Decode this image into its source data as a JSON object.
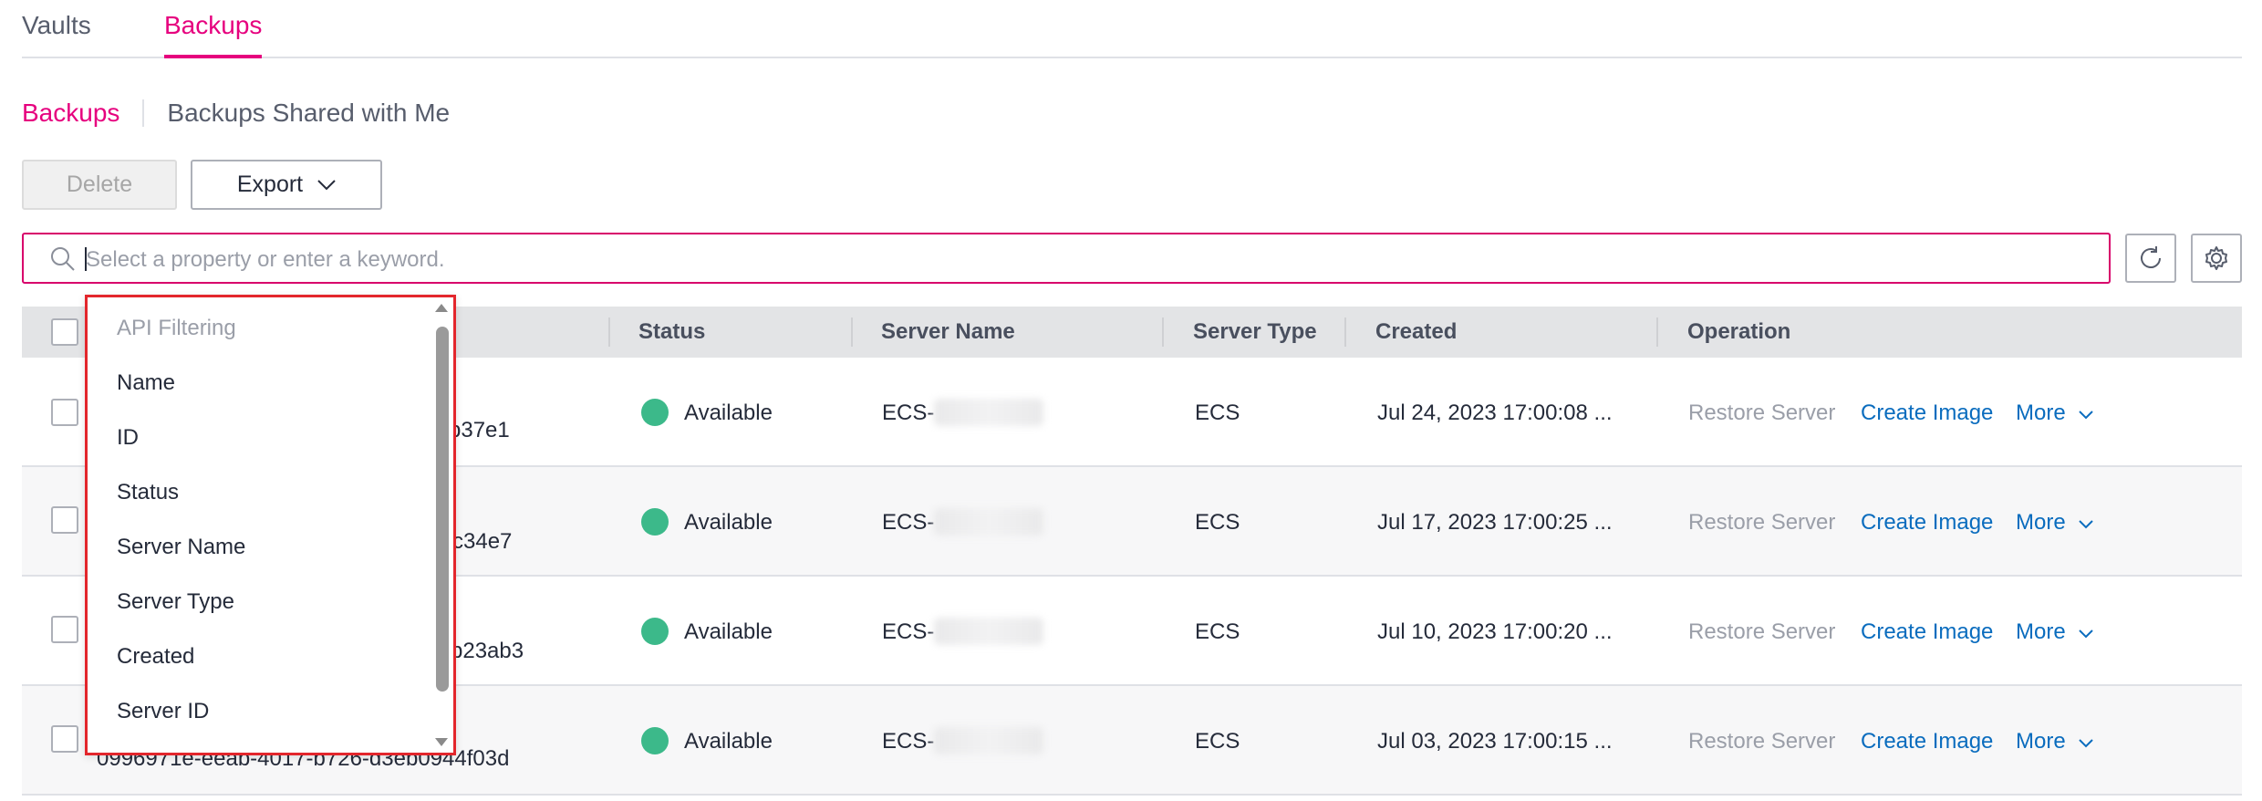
{
  "tabs": [
    {
      "label": "Vaults",
      "active": false
    },
    {
      "label": "Backups",
      "active": true
    }
  ],
  "subnav": {
    "active": "Backups",
    "other": "Backups Shared with Me"
  },
  "toolbar": {
    "delete_label": "Delete",
    "export_label": "Export"
  },
  "search": {
    "placeholder": "Select a property or enter a keyword."
  },
  "table": {
    "columns": [
      "Status",
      "Server Name",
      "Server Type",
      "Created",
      "Operation"
    ],
    "rows": [
      {
        "id_suffix": "b37e1",
        "status": "Available",
        "server_name": "ECS-",
        "server_type": "ECS",
        "created": "Jul 24, 2023 17:00:08 ..."
      },
      {
        "id_suffix": "c34e7",
        "status": "Available",
        "server_name": "ECS-",
        "server_type": "ECS",
        "created": "Jul 17, 2023 17:00:25 ..."
      },
      {
        "id_suffix": "b23ab3",
        "status": "Available",
        "server_name": "ECS-",
        "server_type": "ECS",
        "created": "Jul 10, 2023 17:00:20 ..."
      },
      {
        "id_suffix": "0996971e-eeab-4017-b726-d3eb0944f03d",
        "status": "Available",
        "server_name": "ECS-",
        "server_type": "ECS",
        "created": "Jul 03, 2023 17:00:15 ..."
      }
    ],
    "operations": {
      "restore": "Restore Server",
      "create_image": "Create Image",
      "more": "More"
    }
  },
  "dropdown": {
    "header": "API Filtering",
    "items": [
      "Name",
      "ID",
      "Status",
      "Server Name",
      "Server Type",
      "Created",
      "Server ID"
    ]
  },
  "colors": {
    "accent": "#e6007e",
    "link": "#0a6cbe",
    "status_available": "#3cb98a",
    "dropdown_border": "#e3262c"
  }
}
